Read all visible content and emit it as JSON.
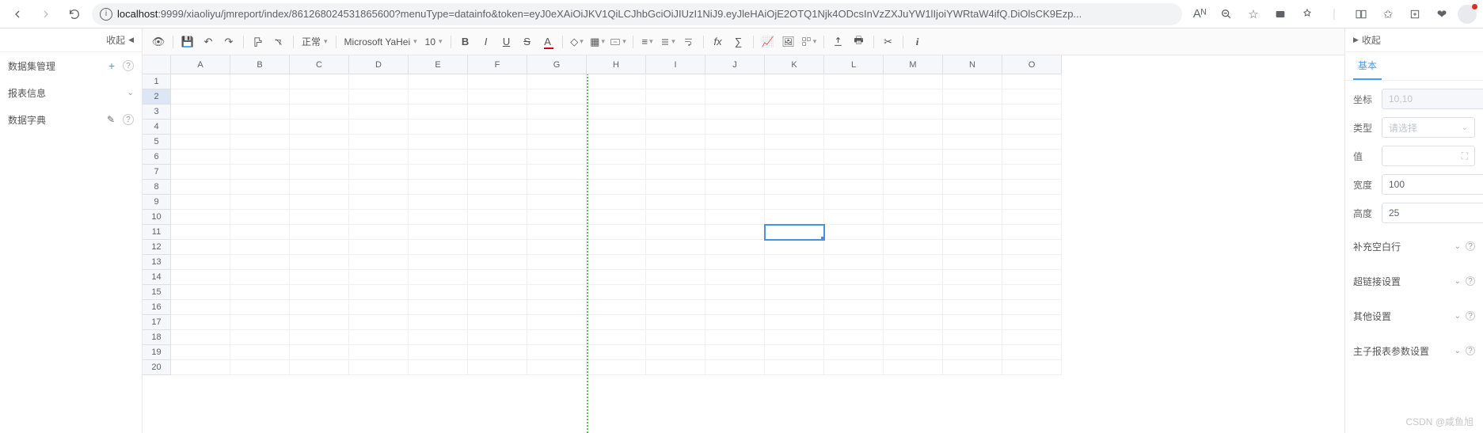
{
  "url": {
    "host": "localhost",
    "port": ":9999",
    "path": "/xiaoliyu/jmreport/index/861268024531865600?menuType=datainfo&token=eyJ0eXAiOiJKV1QiLCJhbGciOiJIUzI1NiJ9.eyJleHAiOjE2OTQ1Njk4ODcsInVzZXJuYW1lIjoiYWRtaW4ifQ.DiOlsCK9Ezp..."
  },
  "browser": {
    "read_aloud": "Aᴺ"
  },
  "left": {
    "collapse": "收起",
    "dataset": {
      "label": "数据集管理"
    },
    "report_info": {
      "label": "报表信息"
    },
    "dict": {
      "label": "数据字典"
    }
  },
  "toolbar": {
    "normal": "正常",
    "font": "Microsoft YaHei",
    "size": "10",
    "bold": "B",
    "italic": "I",
    "underline": "U",
    "strike": "S"
  },
  "columns": [
    "A",
    "B",
    "C",
    "D",
    "E",
    "F",
    "G",
    "H",
    "I",
    "J",
    "K",
    "L",
    "M",
    "N",
    "O"
  ],
  "rows": 20,
  "selected": {
    "row": 11,
    "col": "K"
  },
  "right": {
    "collapse": "收起",
    "tab": "基本",
    "coord": {
      "label": "坐标",
      "placeholder": "10,10"
    },
    "type": {
      "label": "类型",
      "placeholder": "请选择"
    },
    "value": {
      "label": "值"
    },
    "width": {
      "label": "宽度",
      "value": "100"
    },
    "height": {
      "label": "高度",
      "value": "25"
    },
    "acc1": "补充空白行",
    "acc2": "超链接设置",
    "acc3": "其他设置",
    "acc4": "主子报表参数设置"
  },
  "watermark": "CSDN @咸鱼旭"
}
